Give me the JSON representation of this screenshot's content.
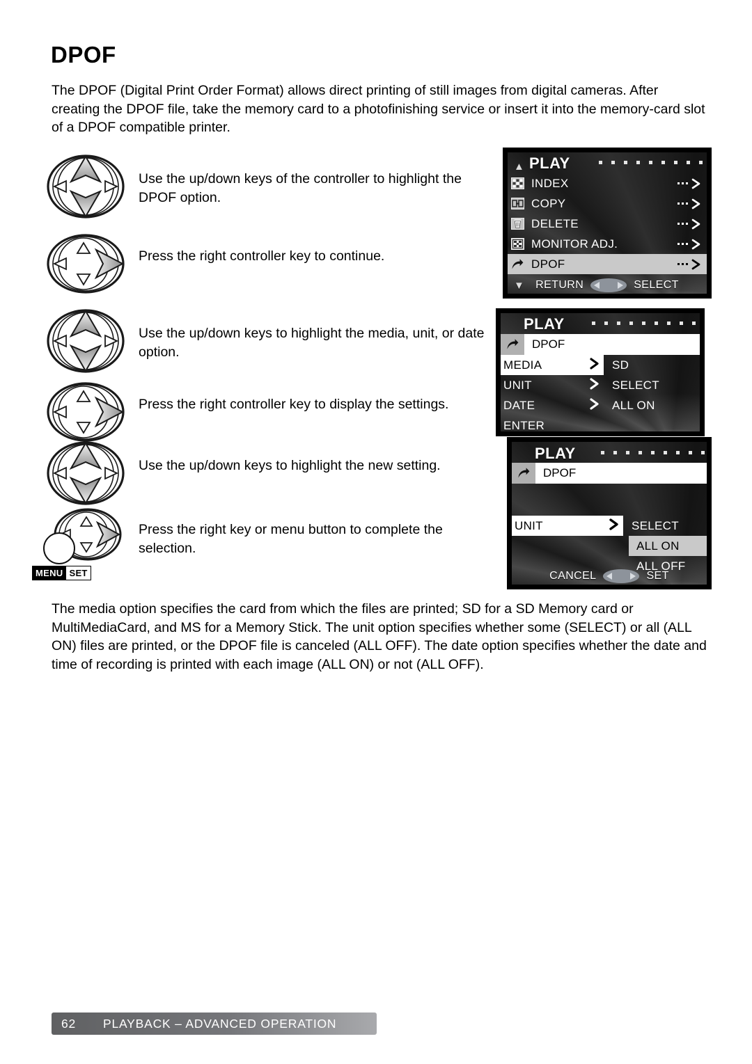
{
  "page": {
    "title": "DPOF",
    "intro": "The DPOF (Digital Print Order Format) allows direct printing of still images from digital cameras. After creating the DPOF file, take the memory card to a photofinishing service or insert it into the memory-card slot of a DPOF compatible printer.",
    "closing": "The media option specifies the card from which the files are printed; SD for a SD Memory card or MultiMediaCard, and MS for a Memory Stick. The unit option specifies whether some (SELECT) or all (ALL ON) files are printed, or the DPOF file is canceled (ALL OFF). The date option specifies whether the date and time of recording is printed with each image (ALL ON) or not (ALL OFF)."
  },
  "steps": [
    {
      "key": "updown",
      "text": "Use the up/down keys of the controller to highlight the DPOF option."
    },
    {
      "key": "right",
      "text": "Press the right controller key to continue."
    },
    {
      "key": "updown",
      "text": "Use the up/down keys to highlight the media, unit, or date option."
    },
    {
      "key": "right",
      "text": "Press the right controller key to display the settings."
    },
    {
      "key": "updown",
      "text": "Use the up/down keys to highlight the new setting."
    },
    {
      "key": "right",
      "text": "Press the right key or menu button to complete the selection."
    }
  ],
  "menu_button": {
    "menu_label": "MENU",
    "set_label": "SET"
  },
  "screen1": {
    "title": "PLAY",
    "dot_count": 11,
    "items": [
      {
        "icon": "index-icon",
        "label": "INDEX",
        "arrow": true,
        "highlight": false
      },
      {
        "icon": "copy-icon",
        "label": "COPY",
        "arrow": true,
        "highlight": false
      },
      {
        "icon": "delete-trash-icon",
        "label": "DELETE",
        "arrow": true,
        "highlight": false
      },
      {
        "icon": "monitor-adj-icon",
        "label": "MONITOR ADJ.",
        "arrow": true,
        "highlight": false
      },
      {
        "icon": "dpof-arrow-icon",
        "label": "DPOF",
        "arrow": true,
        "highlight": true
      }
    ],
    "guide": {
      "left": "RETURN",
      "right": "SELECT"
    }
  },
  "screen2": {
    "title": "PLAY",
    "dot_count": 11,
    "header_label": "DPOF",
    "rows": [
      {
        "name": "MEDIA",
        "value": "SD",
        "chevron": true,
        "selected": true
      },
      {
        "name": "UNIT",
        "value": "SELECT",
        "chevron": true,
        "selected": false
      },
      {
        "name": "DATE",
        "value": "ALL ON",
        "chevron": true,
        "selected": false
      },
      {
        "name": "ENTER",
        "value": "",
        "chevron": false,
        "selected": false
      }
    ]
  },
  "screen3": {
    "title": "PLAY",
    "dot_count": 11,
    "header_label": "DPOF",
    "row": {
      "name": "UNIT",
      "chevron": true,
      "selected": true
    },
    "options": [
      {
        "label": "SELECT",
        "selected": false
      },
      {
        "label": "ALL ON",
        "selected": true
      },
      {
        "label": "ALL OFF",
        "selected": false
      }
    ],
    "guide": {
      "left": "CANCEL",
      "right": "SET"
    }
  },
  "footer": {
    "page_number": "62",
    "section": "PLAYBACK – ADVANCED OPERATION"
  },
  "colors": {
    "highlight_row": "#c9c9c9",
    "selected_field": "#ffffff",
    "lcd_bezel": "#000000",
    "footer_gradient_start": "#5f6062",
    "footer_gradient_end": "#a9aaad"
  }
}
